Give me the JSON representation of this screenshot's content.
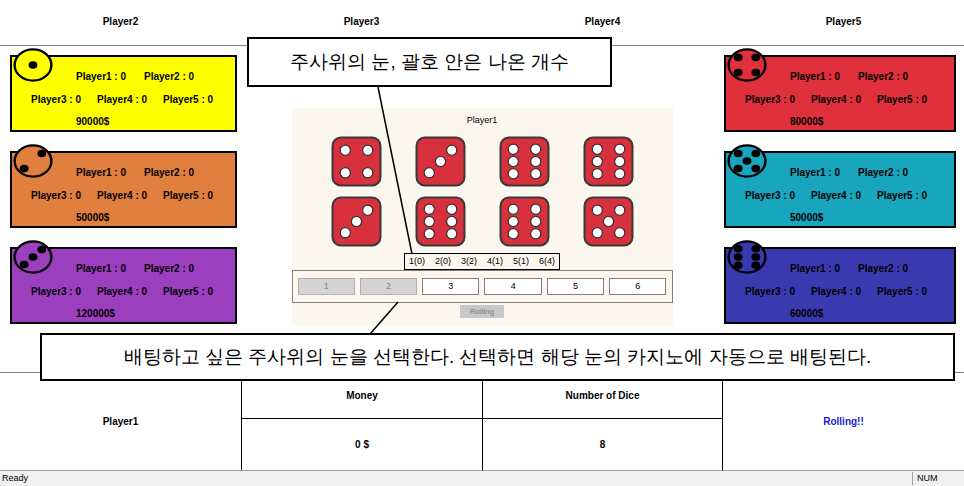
{
  "top_bar": {
    "players": [
      "Player2",
      "Player3",
      "Player4",
      "Player5"
    ]
  },
  "casinos": [
    {
      "side": "left",
      "pips": 1,
      "color": "#ffff00",
      "bets": [
        "Player1 : 0",
        "Player2 : 0",
        "Player3 : 0",
        "Player4 : 0",
        "Player5 : 0"
      ],
      "money": "90000$"
    },
    {
      "side": "left",
      "pips": 2,
      "color": "#e07f3e",
      "bets": [
        "Player1 : 0",
        "Player2 : 0",
        "Player3 : 0",
        "Player4 : 0",
        "Player5 : 0"
      ],
      "money": "50000$"
    },
    {
      "side": "left",
      "pips": 3,
      "color": "#9b3fbf",
      "bets": [
        "Player1 : 0",
        "Player2 : 0",
        "Player3 : 0",
        "Player4 : 0",
        "Player5 : 0"
      ],
      "money": "120000$"
    },
    {
      "side": "right",
      "pips": 4,
      "color": "#e0303c",
      "bets": [
        "Player1 : 0",
        "Player2 : 0",
        "Player3 : 0",
        "Player4 : 0",
        "Player5 : 0"
      ],
      "money": "80000$"
    },
    {
      "side": "right",
      "pips": 5,
      "color": "#17a6bd",
      "bets": [
        "Player1 : 0",
        "Player2 : 0",
        "Player3 : 0",
        "Player4 : 0",
        "Player5 : 0"
      ],
      "money": "50000$"
    },
    {
      "side": "right",
      "pips": 6,
      "color": "#3a3ab0",
      "bets": [
        "Player1 : 0",
        "Player2 : 0",
        "Player3 : 0",
        "Player4 : 0",
        "Player5 : 0"
      ],
      "money": "60000$"
    }
  ],
  "board": {
    "title": "Player1",
    "dice": [
      4,
      3,
      6,
      6,
      3,
      6,
      6,
      5
    ],
    "counts": [
      "1(0)",
      "2(0)",
      "3(2)",
      "4(1)",
      "5(1)",
      "6(4)"
    ],
    "bet_buttons": [
      {
        "label": "1",
        "disabled": true
      },
      {
        "label": "2",
        "disabled": true
      },
      {
        "label": "3",
        "disabled": false
      },
      {
        "label": "4",
        "disabled": false
      },
      {
        "label": "5",
        "disabled": false
      },
      {
        "label": "6",
        "disabled": false
      }
    ],
    "roll_button": {
      "label": "Rolling",
      "disabled": true
    }
  },
  "callouts": [
    {
      "text": "주사위의 눈, 괄호 안은 나온 개수"
    },
    {
      "text": "배팅하고 싶은 주사위의 눈을 선택한다. 선택하면 해당 눈의 카지노에 자동으로 배팅된다."
    }
  ],
  "info_bar": {
    "player": "Player1",
    "money_label": "Money",
    "money": "0 $",
    "dice_label": "Number of Dice",
    "dice": "8",
    "status": "Rolling!!"
  },
  "status_bar": {
    "left": "Ready",
    "right": "NUM"
  }
}
